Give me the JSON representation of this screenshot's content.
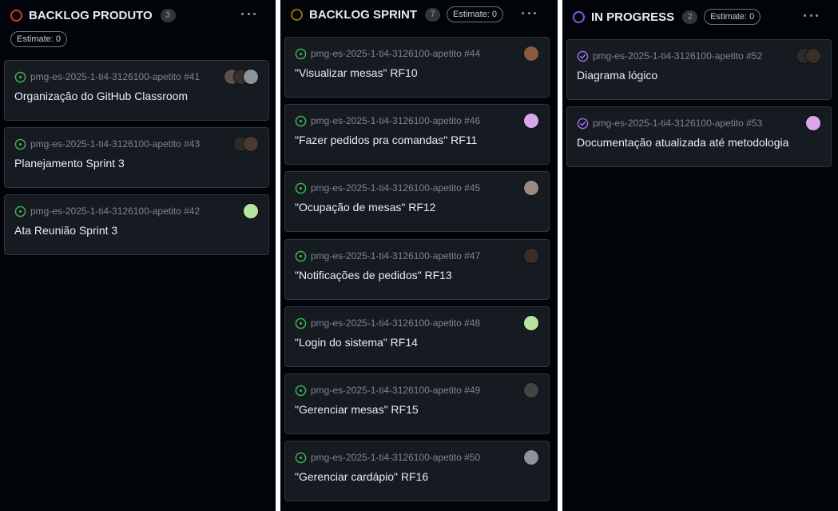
{
  "colors": {
    "todo": "#da3633",
    "sprint": "#9e6a03",
    "progress": "#8957e5",
    "open_issue": "#3fb950",
    "closed_issue": "#a371f7"
  },
  "columns": [
    {
      "title": "BACKLOG PRODUTO",
      "count": "3",
      "estimate": "Estimate: 0",
      "status": "todo",
      "cards": [
        {
          "ref": "pmg-es-2025-1-ti4-3126100-apetito #41",
          "title": "Organização do GitHub Classroom",
          "icon": "issue-opened-icon",
          "avatars": [
            "#3b2f2a",
            "#8c939a"
          ]
        },
        {
          "ref": "pmg-es-2025-1-ti4-3126100-apetito #43",
          "title": "Planejamento Sprint 3",
          "icon": "issue-opened-icon",
          "avatars": [
            "#2b2b2b",
            "#4a3a30"
          ]
        },
        {
          "ref": "pmg-es-2025-1-ti4-3126100-apetito #42",
          "title": "Ata Reunião Sprint 3",
          "icon": "issue-opened-icon",
          "avatars": [
            "#b7e5a0"
          ]
        }
      ]
    },
    {
      "title": "BACKLOG SPRINT",
      "count": "7",
      "estimate": "Estimate: 0",
      "status": "sprint",
      "cards": [
        {
          "ref": "pmg-es-2025-1-ti4-3126100-apetito #44",
          "title": "\"Visualizar mesas\" RF10",
          "icon": "issue-opened-icon",
          "avatars": [
            "#8a5a3c"
          ]
        },
        {
          "ref": "pmg-es-2025-1-ti4-3126100-apetito #46",
          "title": "\"Fazer pedidos pra comandas\" RF11",
          "icon": "issue-opened-icon",
          "avatars": [
            "#d9a6e8"
          ]
        },
        {
          "ref": "pmg-es-2025-1-ti4-3126100-apetito #45",
          "title": "\"Ocupação de mesas\" RF12",
          "icon": "issue-opened-icon",
          "avatars": [
            "#9c8a80"
          ]
        },
        {
          "ref": "pmg-es-2025-1-ti4-3126100-apetito #47",
          "title": "\"Notificações de pedidos\" RF13",
          "icon": "issue-opened-icon",
          "avatars": [
            "#3a2e28"
          ]
        },
        {
          "ref": "pmg-es-2025-1-ti4-3126100-apetito #48",
          "title": "\"Login do sistema\" RF14",
          "icon": "issue-opened-icon",
          "avatars": [
            "#b7e5a0"
          ]
        },
        {
          "ref": "pmg-es-2025-1-ti4-3126100-apetito #49",
          "title": "\"Gerenciar mesas\" RF15",
          "icon": "issue-opened-icon",
          "avatars": [
            "#444444"
          ]
        },
        {
          "ref": "pmg-es-2025-1-ti4-3126100-apetito #50",
          "title": "\"Gerenciar cardápio\" RF16",
          "icon": "issue-opened-icon",
          "avatars": [
            "#8c939a"
          ]
        }
      ]
    },
    {
      "title": "IN PROGRESS",
      "count": "2",
      "estimate": "Estimate: 0",
      "status": "progress",
      "cards": [
        {
          "ref": "pmg-es-2025-1-ti4-3126100-apetito #52",
          "title": "Diagrama lógico",
          "icon": "issue-closed-icon",
          "avatars": [
            "#2b2b2b",
            "#3a2e28"
          ]
        },
        {
          "ref": "pmg-es-2025-1-ti4-3126100-apetito #53",
          "title": "Documentação atualizada até metodologia",
          "icon": "issue-closed-icon",
          "avatars": [
            "#d9a6e8"
          ]
        }
      ]
    }
  ]
}
